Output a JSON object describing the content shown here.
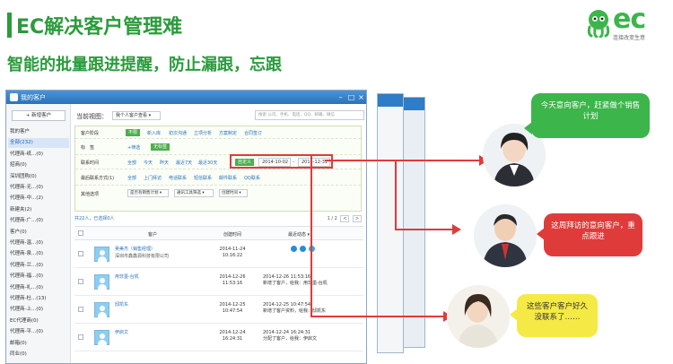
{
  "header": {
    "title": "EC解决客户管理难",
    "subtitle": "智能的批量跟进提醒，防止漏跟，忘跟",
    "logo_text": "ec",
    "logo_tagline": "连接改变生意"
  },
  "window": {
    "title": "我的客户",
    "new_customer_button": "+ 新增客户",
    "sidebar": [
      {
        "label": "我的客户",
        "active": false
      },
      {
        "label": "全部(232)",
        "active": true
      },
      {
        "label": "代理商-纸...(0)",
        "active": false
      },
      {
        "label": "招商(0)",
        "active": false
      },
      {
        "label": "深圳团购(0)",
        "active": false
      },
      {
        "label": "代理商-无...(0)",
        "active": false
      },
      {
        "label": "代理商-中...(2)",
        "active": false
      },
      {
        "label": "新建夹(2)",
        "active": false
      },
      {
        "label": "代理商-广...(0)",
        "active": false
      },
      {
        "label": "客户(0)",
        "active": false
      },
      {
        "label": "代理商-温...(0)",
        "active": false
      },
      {
        "label": "代理商-泉...(0)",
        "active": false
      },
      {
        "label": "代理商-兰...(0)",
        "active": false
      },
      {
        "label": "代理商-福...(0)",
        "active": false
      },
      {
        "label": "代理商-礼...(0)",
        "active": false
      },
      {
        "label": "代理商-杜...(13)",
        "active": false
      },
      {
        "label": "代理商-上...(0)",
        "active": false
      },
      {
        "label": "EC代理商(0)",
        "active": false
      },
      {
        "label": "代理商-平...(0)",
        "active": false
      },
      {
        "label": "邮箱(0)",
        "active": false
      },
      {
        "label": "同业(0)",
        "active": false
      }
    ],
    "view_label": "当前视图：",
    "view_select": "我个人客户查看 ▾",
    "search_placeholder": "搜索 公司、手机、电话、QQ、邮箱、微信",
    "filters": {
      "stage_label": "客户阶段",
      "stage_options": [
        "不限",
        "新入库",
        "初次沟通",
        "立项分析",
        "方案制定",
        "合同签订"
      ],
      "tag_label": "标　签",
      "tag_options": [
        "+筛选",
        "无标签"
      ],
      "contact_label": "联系时间",
      "contact_options": [
        "全部",
        "今天",
        "昨天",
        "最近7天",
        "最近30天"
      ],
      "custom_tag": "自定义",
      "date_from": "2014-10-02",
      "date_sep": "-",
      "date_to": "2014-12-31",
      "method_label": "最后联系方式(1)",
      "method_options": [
        "全部",
        "上门拜访",
        "电话联系",
        "短信联系",
        "邮件联系",
        "QQ联系"
      ],
      "other_label": "其他选项",
      "other_selects": [
        "是否有销售计划 ▾",
        "通讯工具筛选 ▾",
        "创建时间 ▾"
      ]
    },
    "list_summary": "共22人，已选择0人",
    "pager_text": "1 / 2",
    "pager_prev": "<",
    "pager_next": ">",
    "columns": [
      "客户",
      "创建时间",
      "最近动态 ▾"
    ],
    "rows": [
      {
        "name": "吴美杰（销售经理）",
        "company": "深圳市鑫鑫源科技有限公司",
        "date": "2014-11-24",
        "time": "10:16:22",
        "follow1": "",
        "follow2": ""
      },
      {
        "name": "用非墨-台机",
        "company": "",
        "date": "2014-12-26",
        "time": "11:53:16",
        "follow1": "2014-12-26 11:53:16",
        "follow2": "新增了客户，给我：用非墨-台机"
      },
      {
        "name": "邸凯东",
        "company": "",
        "date": "2014-12-25",
        "time": "10:47:54",
        "follow1": "2014-12-25 10:47:54",
        "follow2": "新增了客户资料，给我：邸凯东"
      },
      {
        "name": "伊启文",
        "company": "",
        "date": "2014-12-24",
        "time": "16:24:31",
        "follow1": "2014-12-24 16:24:31",
        "follow2": "分配了客户，给我：伊启文"
      }
    ]
  },
  "bubbles": [
    {
      "text": "今天意向客户，赶紧做个销售计划",
      "color": "#3cb54a"
    },
    {
      "text": "这周拜访的意向客户，重点跟进",
      "color": "#e03b3b"
    },
    {
      "text": "这些客户客户好久没联系了……",
      "color": "#f5e945"
    }
  ],
  "colors": {
    "brand_green": "#2b9b3c",
    "alert_red": "#e23a3a",
    "window_blue": "#2f7cc7"
  }
}
